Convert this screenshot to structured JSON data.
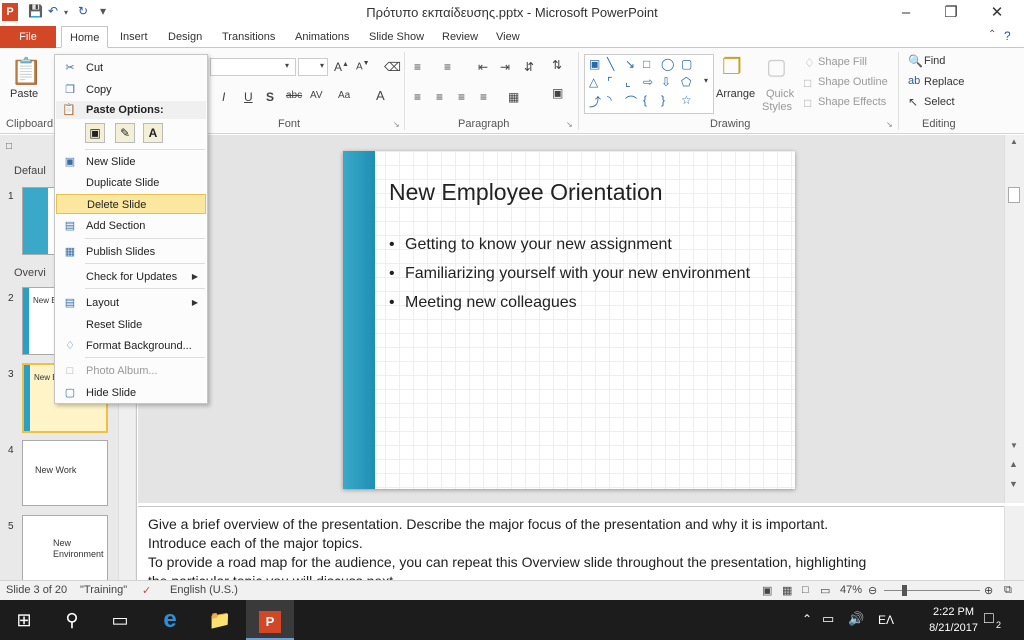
{
  "app": {
    "title": "Πρότυπο εκπαίδευσης.pptx - Microsoft PowerPoint",
    "logo_letter": "P"
  },
  "tabs": {
    "file": "File",
    "items": [
      "Home",
      "Insert",
      "Design",
      "Transitions",
      "Animations",
      "Slide Show",
      "Review",
      "View"
    ]
  },
  "ribbon": {
    "clipboard": "Clipboard",
    "paste": "Paste",
    "font": "Font",
    "paragraph": "Paragraph",
    "drawing": "Drawing",
    "editing": "Editing",
    "arrange": "Arrange",
    "quick_styles_1": "Quick",
    "quick_styles_2": "Styles",
    "shape_fill": "Shape Fill",
    "shape_outline": "Shape Outline",
    "shape_effects": "Shape Effects",
    "find": "Find",
    "replace": "Replace",
    "select": "Select"
  },
  "context_menu": {
    "cut": "Cut",
    "copy": "Copy",
    "paste_options": "Paste Options:",
    "new_slide": "New Slide",
    "duplicate_slide": "Duplicate Slide",
    "delete_slide": "Delete Slide",
    "add_section": "Add Section",
    "publish_slides": "Publish Slides",
    "check_updates": "Check for Updates",
    "layout": "Layout",
    "reset_slide": "Reset Slide",
    "format_background": "Format Background...",
    "photo_album": "Photo Album...",
    "hide_slide": "Hide Slide"
  },
  "slides_panel": {
    "section1": "Defaul",
    "section2": "Overvi",
    "thumb4_text": "New Work",
    "thumb5_text_1": "New",
    "thumb5_text_2": "Environment",
    "thumb2_text": "New Emp",
    "thumb3_text": "New Emp"
  },
  "slide": {
    "title": "New Employee Orientation",
    "bullets": [
      "Getting to know your new assignment",
      "Familiarizing yourself with your new environment",
      "Meeting new colleagues"
    ]
  },
  "notes": {
    "line1": "Give a brief overview of the presentation. Describe the major focus of the presentation and why it is important.",
    "line2": "Introduce each of the major topics.",
    "line3": "To provide a road map for the audience, you can repeat this Overview slide throughout the presentation, highlighting",
    "line4": "the particular topic you will discuss next."
  },
  "status": {
    "slide_info": "Slide 3 of 20",
    "theme": "\"Training\"",
    "language": "English (U.S.)",
    "zoom": "47%"
  },
  "taskbar": {
    "time": "2:22 PM",
    "date": "8/21/2017",
    "lang": "ΕΛ",
    "notif_count": "2"
  }
}
